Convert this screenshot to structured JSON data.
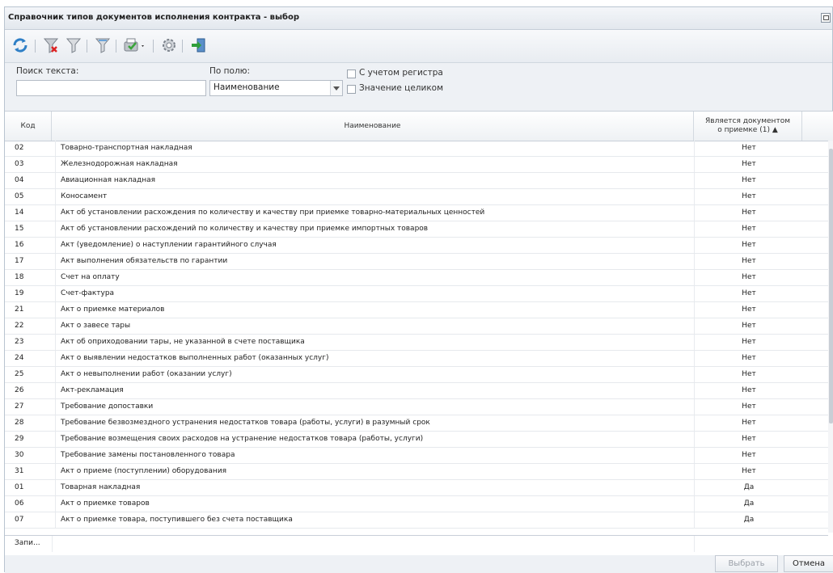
{
  "window": {
    "title": "Справочник типов документов исполнения контракта - выбор"
  },
  "toolbar": {
    "icons": [
      "refresh-icon",
      "filter-clear-icon",
      "filter-icon",
      "filter-apply-icon",
      "approve-dropdown-icon",
      "settings-icon",
      "exit-icon"
    ]
  },
  "search": {
    "label": "Поиск текста:",
    "value": "",
    "field_label": "По полю:",
    "field_value": "Наименование",
    "case_label": "С учетом регистра",
    "whole_label": "Значение целиком"
  },
  "table": {
    "headers": {
      "code": "Код",
      "name": "Наименование",
      "flag": "Является документом о приемке (1) ▲"
    },
    "rows": [
      {
        "code": "02",
        "name": "Товарно-транспортная накладная",
        "flag": "Нет"
      },
      {
        "code": "03",
        "name": "Железнодорожная накладная",
        "flag": "Нет"
      },
      {
        "code": "04",
        "name": "Авиационная накладная",
        "flag": "Нет"
      },
      {
        "code": "05",
        "name": "Коносамент",
        "flag": "Нет"
      },
      {
        "code": "14",
        "name": "Акт об установлении расхождения по количеству и качеству при приемке товарно-материальных ценностей",
        "flag": "Нет"
      },
      {
        "code": "15",
        "name": "Акт об установлении расхождений по количеству и качеству при приемке импортных товаров",
        "flag": "Нет"
      },
      {
        "code": "16",
        "name": "Акт (уведомление) о наступлении гарантийного случая",
        "flag": "Нет"
      },
      {
        "code": "17",
        "name": "Акт выполнения обязательств по гарантии",
        "flag": "Нет"
      },
      {
        "code": "18",
        "name": "Счет на оплату",
        "flag": "Нет"
      },
      {
        "code": "19",
        "name": "Счет-фактура",
        "flag": "Нет"
      },
      {
        "code": "21",
        "name": "Акт о приемке материалов",
        "flag": "Нет"
      },
      {
        "code": "22",
        "name": "Акт о завесе тары",
        "flag": "Нет"
      },
      {
        "code": "23",
        "name": "Акт об оприходовании тары, не указанной в счете поставщика",
        "flag": "Нет"
      },
      {
        "code": "24",
        "name": "Акт о выявлении недостатков выполненных работ (оказанных услуг)",
        "flag": "Нет"
      },
      {
        "code": "25",
        "name": "Акт о невыполнении работ (оказании услуг)",
        "flag": "Нет"
      },
      {
        "code": "26",
        "name": "Акт-рекламация",
        "flag": "Нет"
      },
      {
        "code": "27",
        "name": "Требование допоставки",
        "flag": "Нет"
      },
      {
        "code": "28",
        "name": "Требование безвозмездного устранения недостатков товара (работы, услуги) в разумный срок",
        "flag": "Нет"
      },
      {
        "code": "29",
        "name": "Требование возмещения своих расходов на устранение недостатков товара (работы, услуги)",
        "flag": "Нет"
      },
      {
        "code": "30",
        "name": "Требование замены постановленного товара",
        "flag": "Нет"
      },
      {
        "code": "31",
        "name": "Акт о приеме (поступлении) оборудования",
        "flag": "Нет"
      },
      {
        "code": "01",
        "name": "Товарная накладная",
        "flag": "Да"
      },
      {
        "code": "06",
        "name": "Акт о приемке товаров",
        "flag": "Да"
      },
      {
        "code": "07",
        "name": "Акт о приемке товара, поступившего без счета поставщика",
        "flag": "Да"
      }
    ],
    "footer_label": "Запи..."
  },
  "buttons": {
    "select": "Выбрать",
    "cancel": "Отмена"
  }
}
